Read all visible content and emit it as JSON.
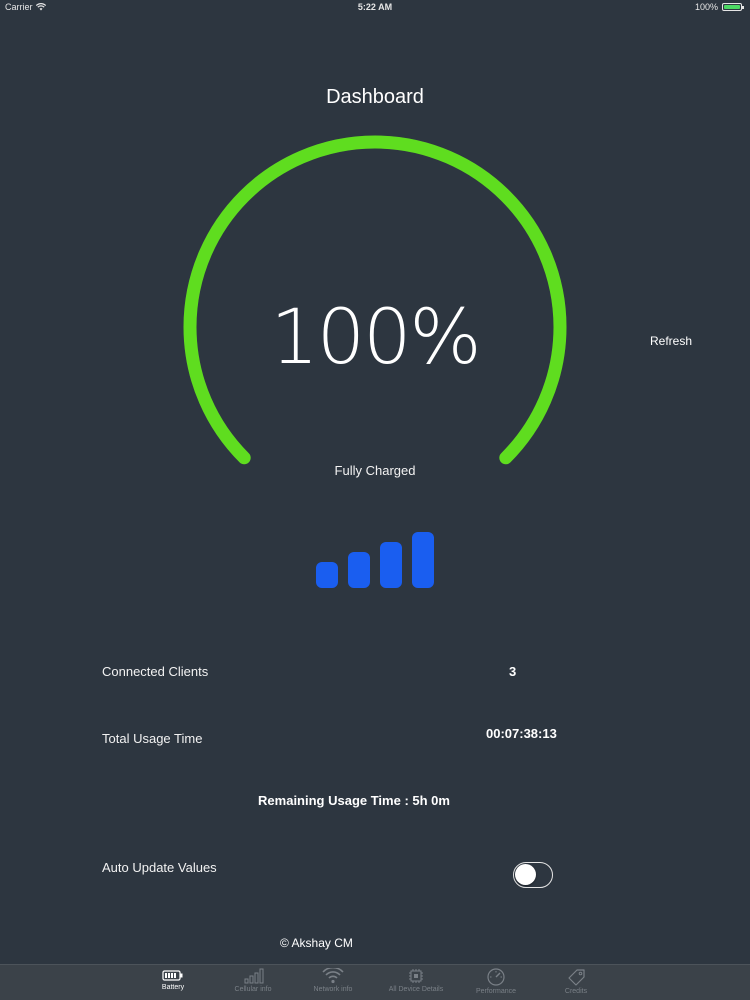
{
  "status_bar": {
    "carrier": "Carrier",
    "time": "5:22 AM",
    "battery_text": "100%",
    "battery_level": 1.0
  },
  "header": {
    "title": "Dashboard"
  },
  "gauge": {
    "percent_text": "100%",
    "level": 1.0,
    "status": "Fully Charged",
    "color": "#5fdd1f"
  },
  "refresh_label": "Refresh",
  "signal": {
    "bars": 4,
    "color": "#1a5ef0"
  },
  "stats": {
    "connected_clients_label": "Connected Clients",
    "connected_clients_value": "3",
    "total_usage_label": "Total Usage Time",
    "total_usage_value": "00:07:38:13",
    "remaining_text": "Remaining Usage Time : 5h 0m",
    "auto_update_label": "Auto Update Values",
    "auto_update_on": false
  },
  "footer": {
    "copyright": "© Akshay CM"
  },
  "tabs": [
    {
      "label": "Battery",
      "icon": "battery-icon",
      "active": true
    },
    {
      "label": "Cellular info",
      "icon": "cellular-icon",
      "active": false
    },
    {
      "label": "Network info",
      "icon": "wifi-icon",
      "active": false
    },
    {
      "label": "All Device Details",
      "icon": "chip-icon",
      "active": false
    },
    {
      "label": "Performance",
      "icon": "speedometer-icon",
      "active": false
    },
    {
      "label": "Credits",
      "icon": "tag-icon",
      "active": false
    }
  ],
  "colors": {
    "background": "#2d3640",
    "accent_green": "#5fdd1f",
    "signal_blue": "#1a5ef0",
    "tabbar": "#3b4249"
  }
}
